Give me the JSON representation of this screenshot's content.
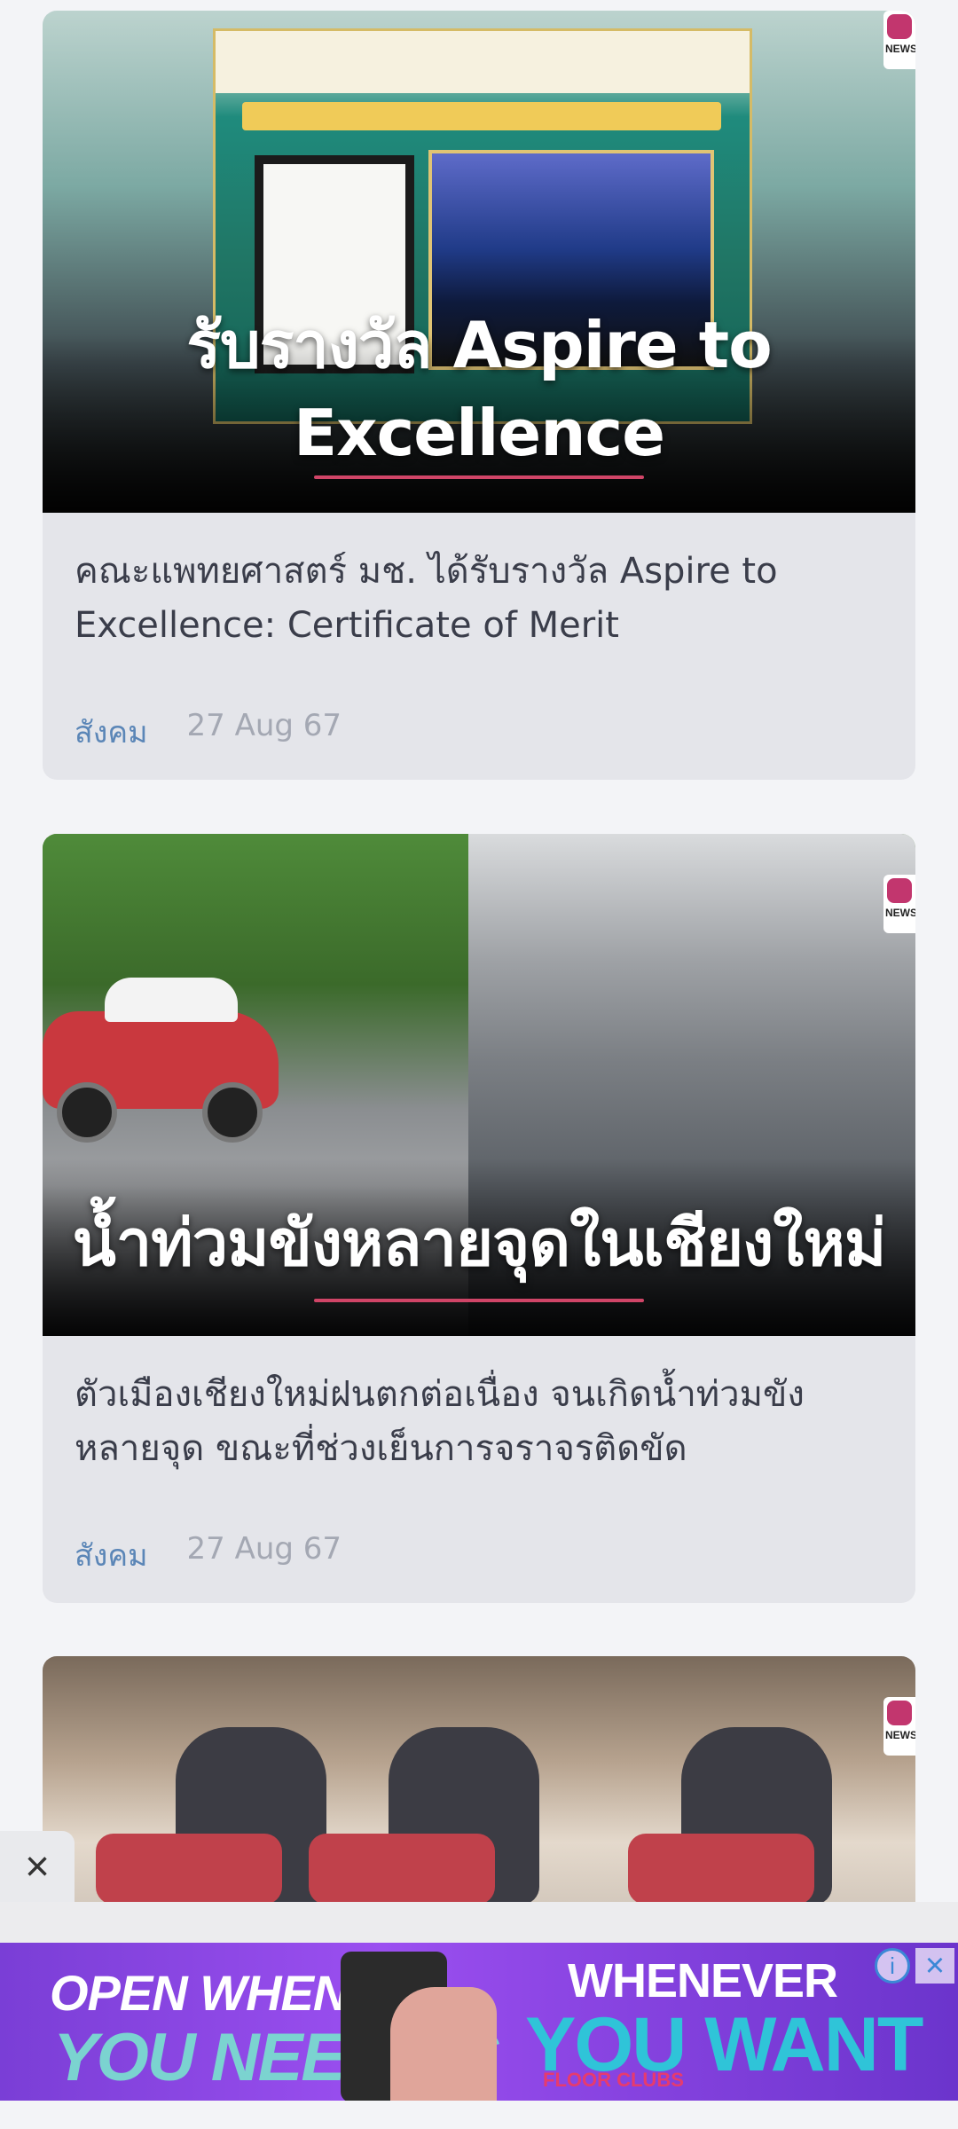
{
  "articles": [
    {
      "image_overlay_title": "รับรางวัล Aspire to Excellence",
      "headline": "คณะแพทยศาสตร์ มช. ได้รับรางวัล Aspire to Excellence: Certificate of Merit",
      "category": "สังคม",
      "date": "27 Aug 67",
      "badge_text": "NEWS"
    },
    {
      "image_overlay_title": "น้ำท่วมขังหลายจุดในเชียงใหม่",
      "headline": "ตัวเมืองเชียงใหม่ฝนตกต่อเนื่อง จนเกิดน้ำท่วมขังหลายจุด ขณะที่ช่วงเย็นการจราจรติดขัด",
      "category": "สังคม",
      "date": "27 Aug 67",
      "badge_text": "NEWS"
    },
    {
      "badge_text": "NEWS"
    }
  ],
  "ad": {
    "line1": "OPEN WHEN",
    "line2": "YOU NEED US",
    "line3": "WHENEVER",
    "line4": "YOU WANT",
    "line5": "FLOOR CLUBS"
  },
  "icons": {
    "close": "×",
    "ad_info": "i",
    "ad_close": "×"
  },
  "colors": {
    "category": "#5b86b7",
    "accent_underline": "#d04567",
    "ad_background": "#8b45e3"
  }
}
